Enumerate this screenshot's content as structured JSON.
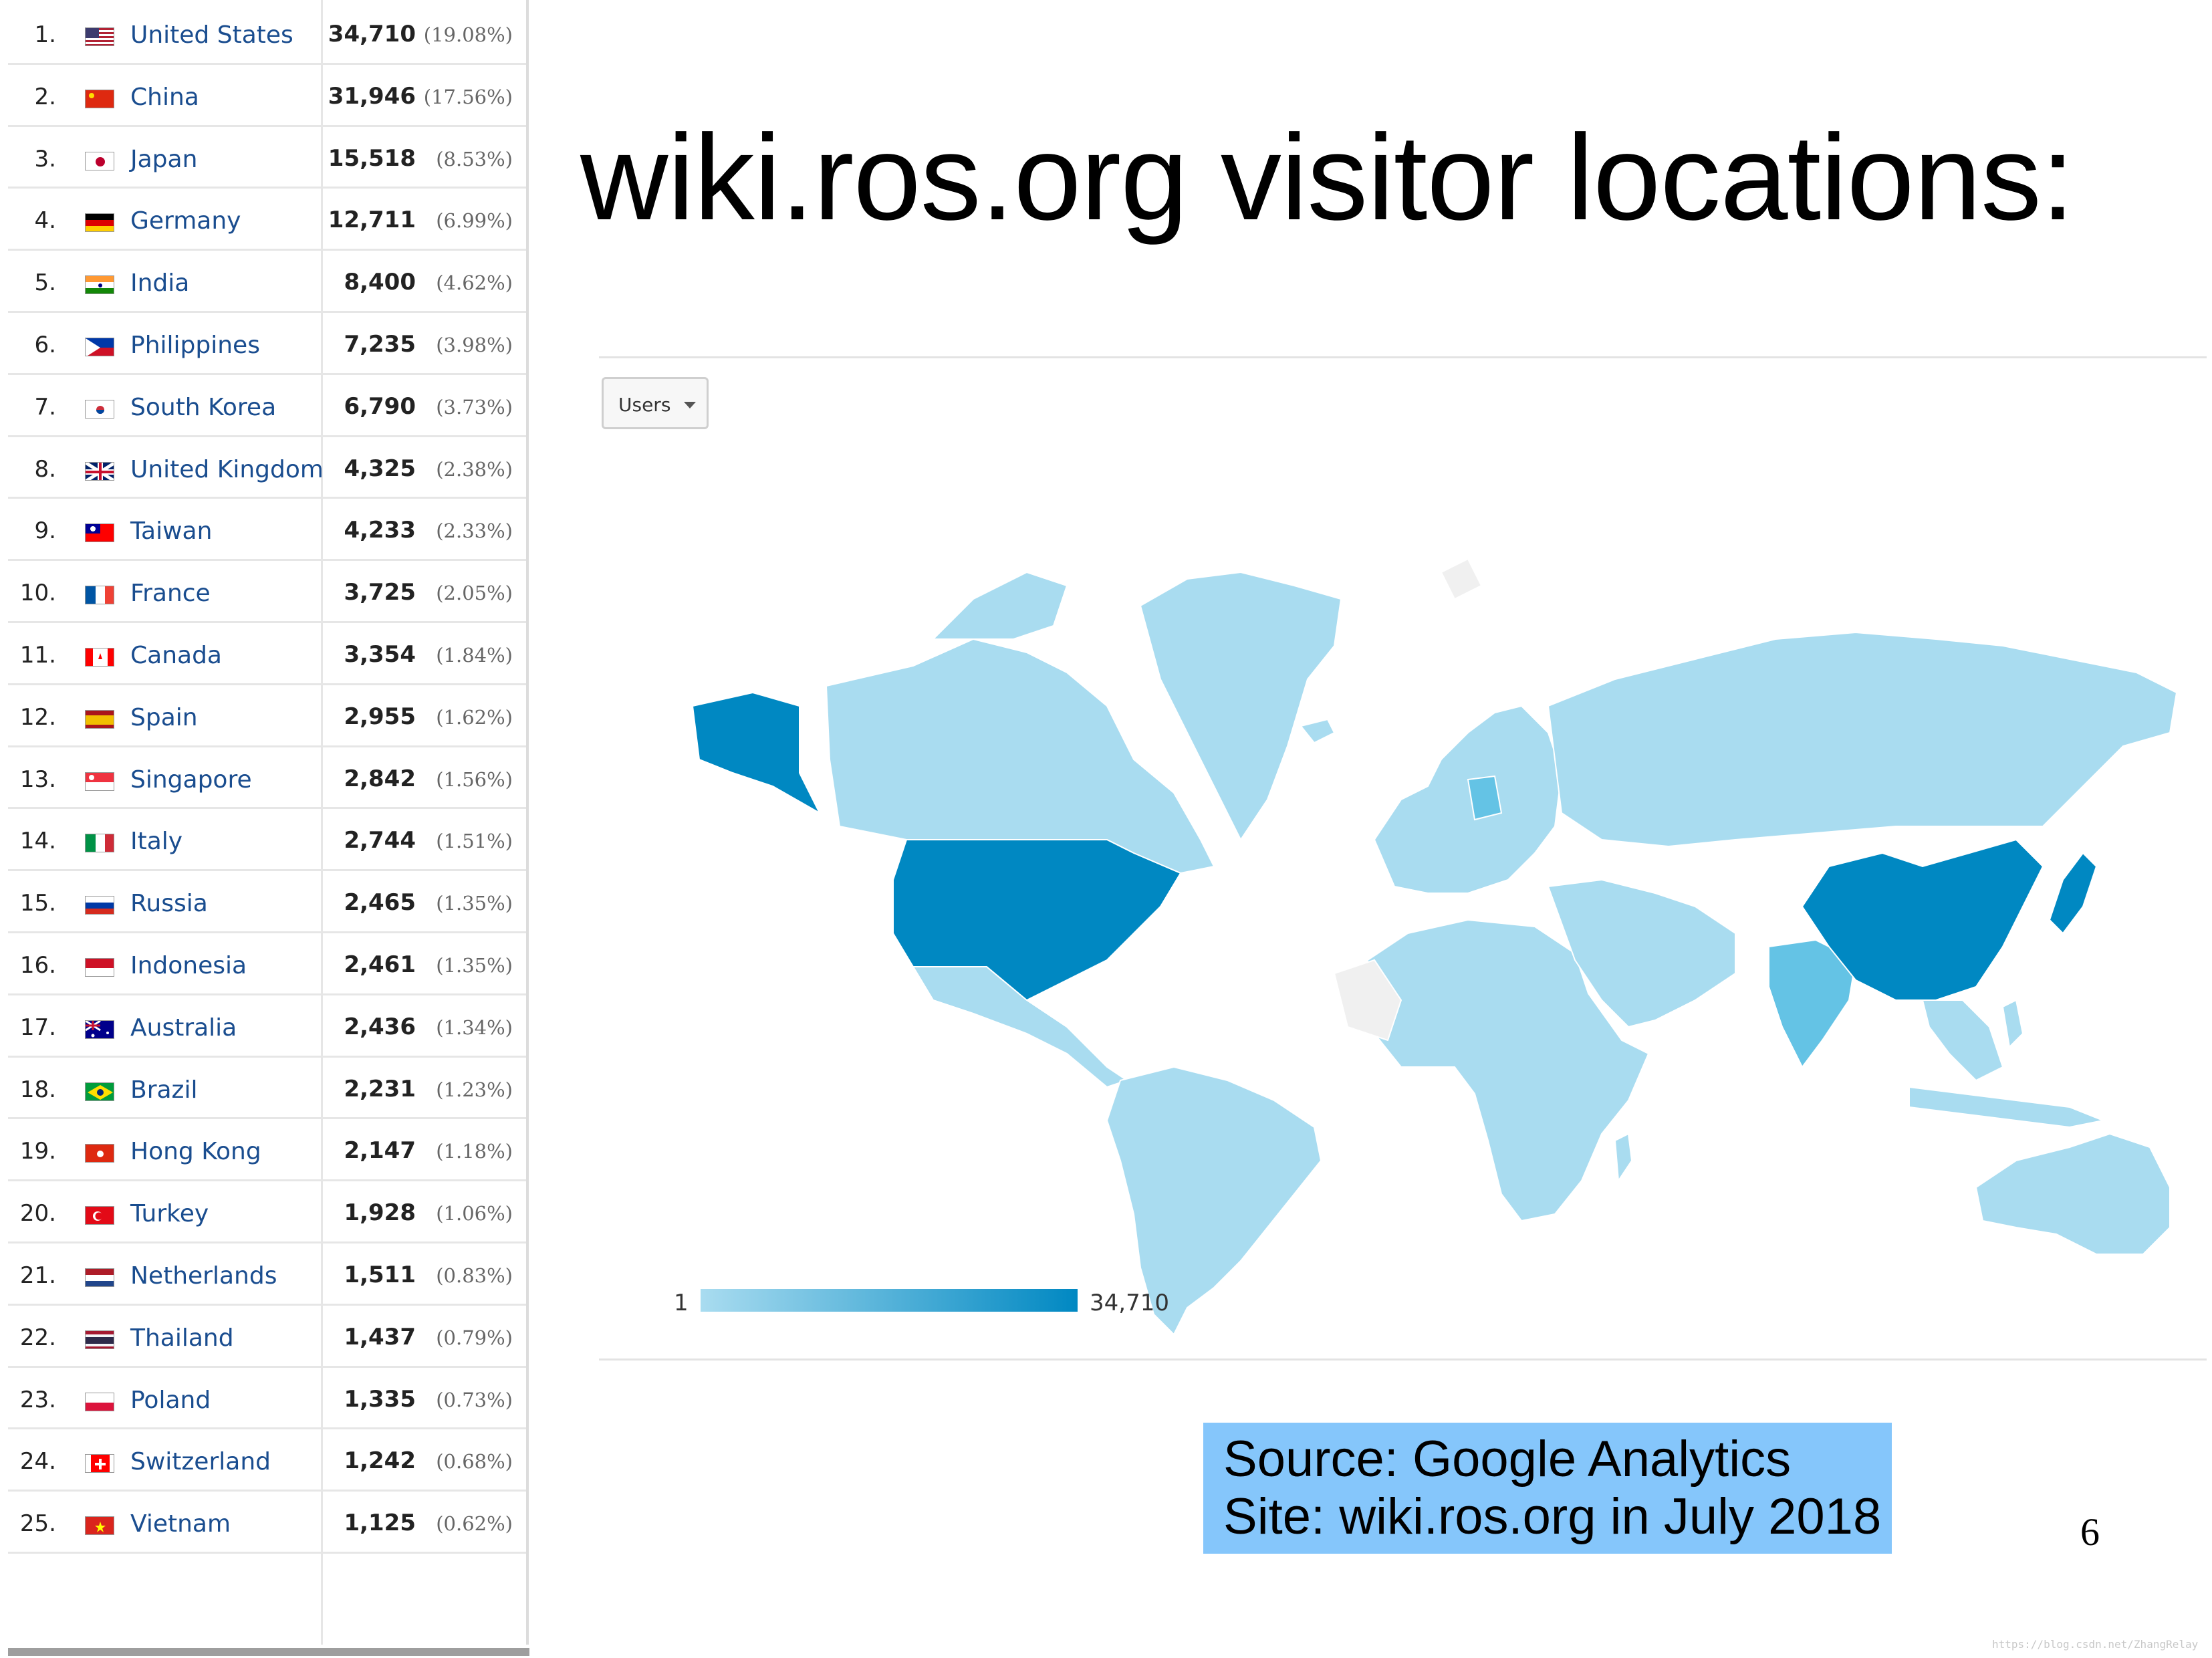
{
  "title": "wiki.ros.org visitor locations:",
  "countries": [
    {
      "rank": "1.",
      "name": "United States",
      "users": "34,710",
      "pct": "(19.08%)",
      "flag": "us"
    },
    {
      "rank": "2.",
      "name": "China",
      "users": "31,946",
      "pct": "(17.56%)",
      "flag": "cn"
    },
    {
      "rank": "3.",
      "name": "Japan",
      "users": "15,518",
      "pct": "(8.53%)",
      "flag": "jp"
    },
    {
      "rank": "4.",
      "name": "Germany",
      "users": "12,711",
      "pct": "(6.99%)",
      "flag": "de"
    },
    {
      "rank": "5.",
      "name": "India",
      "users": "8,400",
      "pct": "(4.62%)",
      "flag": "in"
    },
    {
      "rank": "6.",
      "name": "Philippines",
      "users": "7,235",
      "pct": "(3.98%)",
      "flag": "ph"
    },
    {
      "rank": "7.",
      "name": "South Korea",
      "users": "6,790",
      "pct": "(3.73%)",
      "flag": "kr"
    },
    {
      "rank": "8.",
      "name": "United Kingdom",
      "users": "4,325",
      "pct": "(2.38%)",
      "flag": "gb"
    },
    {
      "rank": "9.",
      "name": "Taiwan",
      "users": "4,233",
      "pct": "(2.33%)",
      "flag": "tw"
    },
    {
      "rank": "10.",
      "name": "France",
      "users": "3,725",
      "pct": "(2.05%)",
      "flag": "fr"
    },
    {
      "rank": "11.",
      "name": "Canada",
      "users": "3,354",
      "pct": "(1.84%)",
      "flag": "ca"
    },
    {
      "rank": "12.",
      "name": "Spain",
      "users": "2,955",
      "pct": "(1.62%)",
      "flag": "es"
    },
    {
      "rank": "13.",
      "name": "Singapore",
      "users": "2,842",
      "pct": "(1.56%)",
      "flag": "sg"
    },
    {
      "rank": "14.",
      "name": "Italy",
      "users": "2,744",
      "pct": "(1.51%)",
      "flag": "it"
    },
    {
      "rank": "15.",
      "name": "Russia",
      "users": "2,465",
      "pct": "(1.35%)",
      "flag": "ru"
    },
    {
      "rank": "16.",
      "name": "Indonesia",
      "users": "2,461",
      "pct": "(1.35%)",
      "flag": "id"
    },
    {
      "rank": "17.",
      "name": "Australia",
      "users": "2,436",
      "pct": "(1.34%)",
      "flag": "au"
    },
    {
      "rank": "18.",
      "name": "Brazil",
      "users": "2,231",
      "pct": "(1.23%)",
      "flag": "br"
    },
    {
      "rank": "19.",
      "name": "Hong Kong",
      "users": "2,147",
      "pct": "(1.18%)",
      "flag": "hk"
    },
    {
      "rank": "20.",
      "name": "Turkey",
      "users": "1,928",
      "pct": "(1.06%)",
      "flag": "tr"
    },
    {
      "rank": "21.",
      "name": "Netherlands",
      "users": "1,511",
      "pct": "(0.83%)",
      "flag": "nl"
    },
    {
      "rank": "22.",
      "name": "Thailand",
      "users": "1,437",
      "pct": "(0.79%)",
      "flag": "th"
    },
    {
      "rank": "23.",
      "name": "Poland",
      "users": "1,335",
      "pct": "(0.73%)",
      "flag": "pl"
    },
    {
      "rank": "24.",
      "name": "Switzerland",
      "users": "1,242",
      "pct": "(0.68%)",
      "flag": "ch"
    },
    {
      "rank": "25.",
      "name": "Vietnam",
      "users": "1,125",
      "pct": "(0.62%)",
      "flag": "vn"
    }
  ],
  "map": {
    "metric": "Users",
    "legend_min": "1",
    "legend_max": "34,710",
    "colors": {
      "low": "#a9dcf0",
      "mid": "#64c3e5",
      "high": "#0088c2",
      "no_data": "#f0f0f0",
      "border": "#ffffff"
    }
  },
  "source": {
    "line1": "Source: Google Analytics",
    "line2": "Site: wiki.ros.org in July 2018"
  },
  "page_number": "6",
  "watermark": "https://blog.csdn.net/ZhangRelay"
}
